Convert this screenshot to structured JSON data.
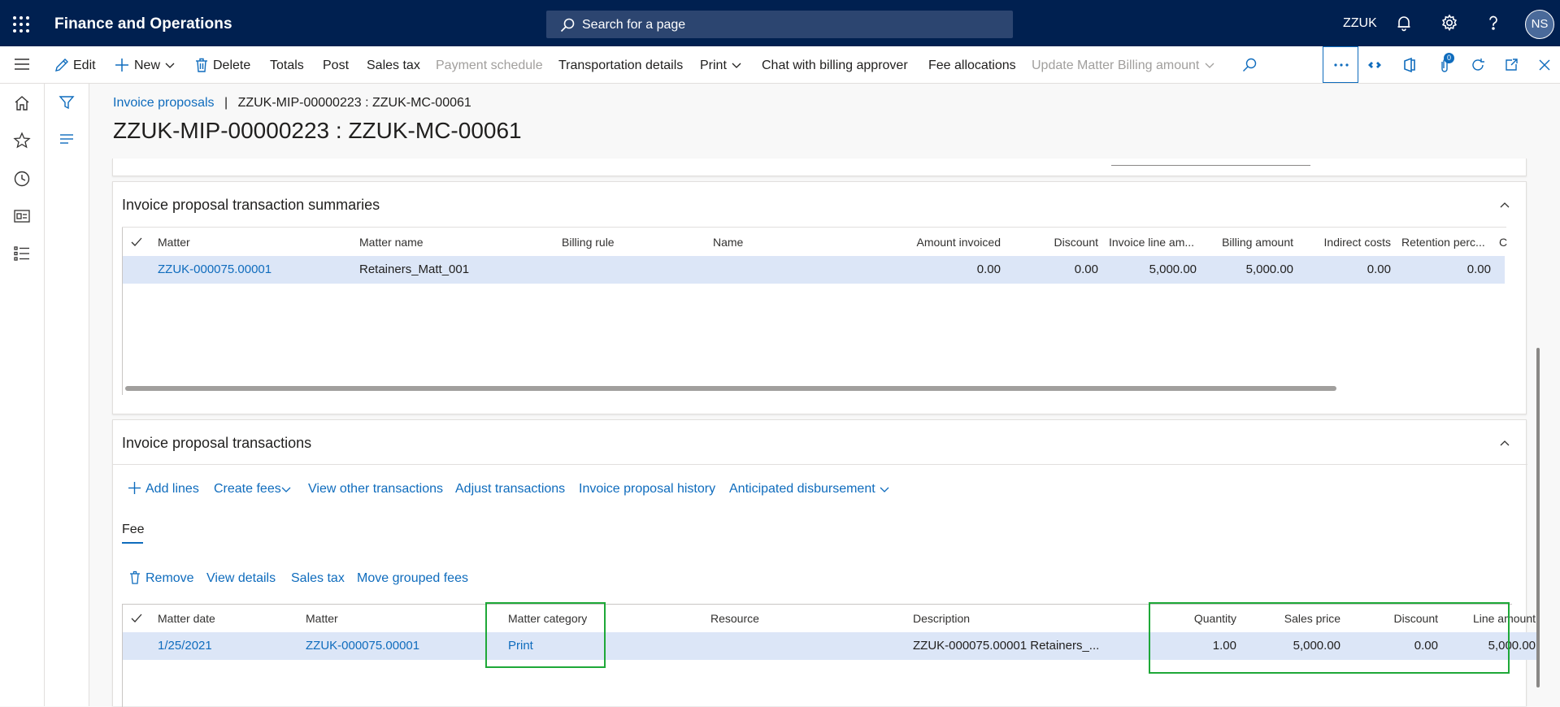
{
  "header": {
    "app_title": "Finance and Operations",
    "search_placeholder": "Search for a page",
    "company": "ZZUK",
    "avatar_initials": "NS",
    "icons": [
      "waffle-icon",
      "bell-icon",
      "gear-icon",
      "help-icon"
    ]
  },
  "actions": {
    "edit": "Edit",
    "new": "New",
    "delete": "Delete",
    "totals": "Totals",
    "post": "Post",
    "sales_tax": "Sales tax",
    "payment_schedule": "Payment schedule",
    "transportation_details": "Transportation details",
    "print": "Print",
    "chat": "Chat with billing approver",
    "fee_allocations": "Fee allocations",
    "update_billing": "Update Matter Billing amount",
    "notification_count": "0"
  },
  "breadcrumb": {
    "parent": "Invoice proposals",
    "separator": "|",
    "current": "ZZUK-MIP-00000223 : ZZUK-MC-00061"
  },
  "page_title": "ZZUK-MIP-00000223 : ZZUK-MC-00061",
  "summaries": {
    "title": "Invoice proposal transaction summaries",
    "columns": [
      "Matter",
      "Matter name",
      "Billing rule",
      "Name",
      "Amount invoiced",
      "Discount",
      "Invoice line am...",
      "Billing amount",
      "Indirect costs",
      "Retention perc...",
      "C"
    ],
    "row": {
      "matter": "ZZUK-000075.00001",
      "matter_name": "Retainers_Matt_001",
      "billing_rule": "",
      "name": "",
      "amount_invoiced": "0.00",
      "discount": "0.00",
      "invoice_line_amount": "5,000.00",
      "billing_amount": "5,000.00",
      "indirect_costs": "0.00",
      "retention": "0.00"
    }
  },
  "transactions": {
    "title": "Invoice proposal transactions",
    "toolbar": {
      "add_lines": "Add lines",
      "create_fees": "Create fees",
      "view_other": "View other transactions",
      "adjust": "Adjust transactions",
      "history": "Invoice proposal history",
      "anticipated": "Anticipated disbursement"
    },
    "tab": "Fee",
    "fee_toolbar": {
      "remove": "Remove",
      "view_details": "View details",
      "sales_tax": "Sales tax",
      "move_grouped": "Move grouped fees"
    },
    "columns": [
      "Matter date",
      "Matter",
      "Matter category",
      "Resource",
      "Description",
      "Quantity",
      "Sales price",
      "Discount",
      "Line amount"
    ],
    "row": {
      "matter_date": "1/25/2021",
      "matter": "ZZUK-000075.00001",
      "matter_category": "Print",
      "resource": "",
      "description": "ZZUK-000075.00001 Retainers_...",
      "quantity": "1.00",
      "sales_price": "5,000.00",
      "discount": "0.00",
      "line_amount": "5,000.00"
    }
  },
  "colors": {
    "header_bg": "#002050",
    "link": "#0f6cbd",
    "selected_row": "#dce6f7",
    "highlight_box": "#1ea838"
  }
}
